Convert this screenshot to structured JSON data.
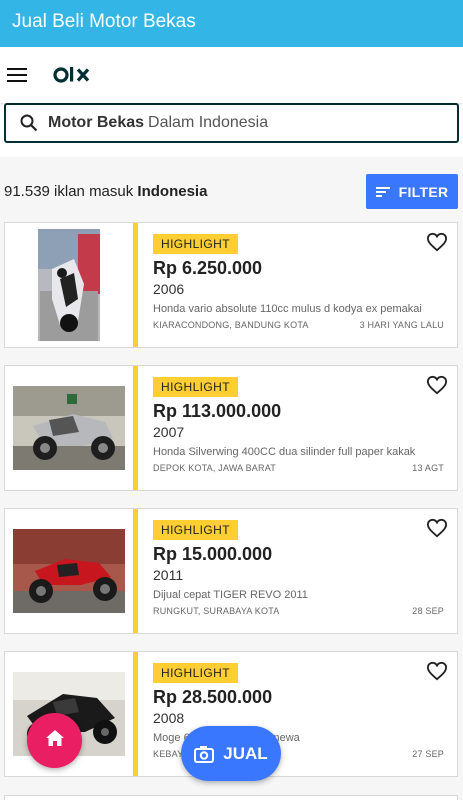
{
  "app": {
    "title": "Jual Beli Motor Bekas"
  },
  "navbar": {
    "logo_text": "olx"
  },
  "search": {
    "keyword": "Motor Bekas",
    "location_text": "Dalam Indonesia"
  },
  "results": {
    "count_text": "91.539 iklan masuk",
    "location": "Indonesia"
  },
  "filter": {
    "label": "FILTER"
  },
  "listings": [
    {
      "badge": "HIGHLIGHT",
      "price": "Rp 6.250.000",
      "year": "2006",
      "description": "Honda vario absolute 110cc mulus d kodya ex pemakai",
      "location": "KIARACONDONG, BANDUNG KOTA",
      "date": "3 HARI YANG LALU"
    },
    {
      "badge": "HIGHLIGHT",
      "price": "Rp 113.000.000",
      "year": "2007",
      "description": "Honda Silverwing 400CC dua silinder full paper kakak",
      "location": "DEPOK KOTA, JAWA BARAT",
      "date": "13 AGT"
    },
    {
      "badge": "HIGHLIGHT",
      "price": "Rp 15.000.000",
      "year": "2011",
      "description": "Dijual cepat TIGER REVO 2011",
      "location": "RUNGKUT, SURABAYA KOTA",
      "date": "28 SEP"
    },
    {
      "badge": "HIGHLIGHT",
      "price": "Rp 28.500.000",
      "year": "2008",
      "description": "Moge   60 tahun 2008 istimewa",
      "location": "KEBAY   A SELAT...",
      "date": "27 SEP"
    }
  ],
  "fab": {
    "sell_label": "JUAL"
  },
  "colors": {
    "header": "#33b5e5",
    "accent": "#3a77ff",
    "highlight": "#ffce32",
    "home_fab": "#e91e63",
    "brand_dark": "#002f34"
  },
  "icons": {
    "menu": "hamburger-icon",
    "search": "search-icon",
    "filter": "filter-icon",
    "favorite": "heart-icon",
    "home": "home-icon",
    "sell": "camera-icon"
  }
}
